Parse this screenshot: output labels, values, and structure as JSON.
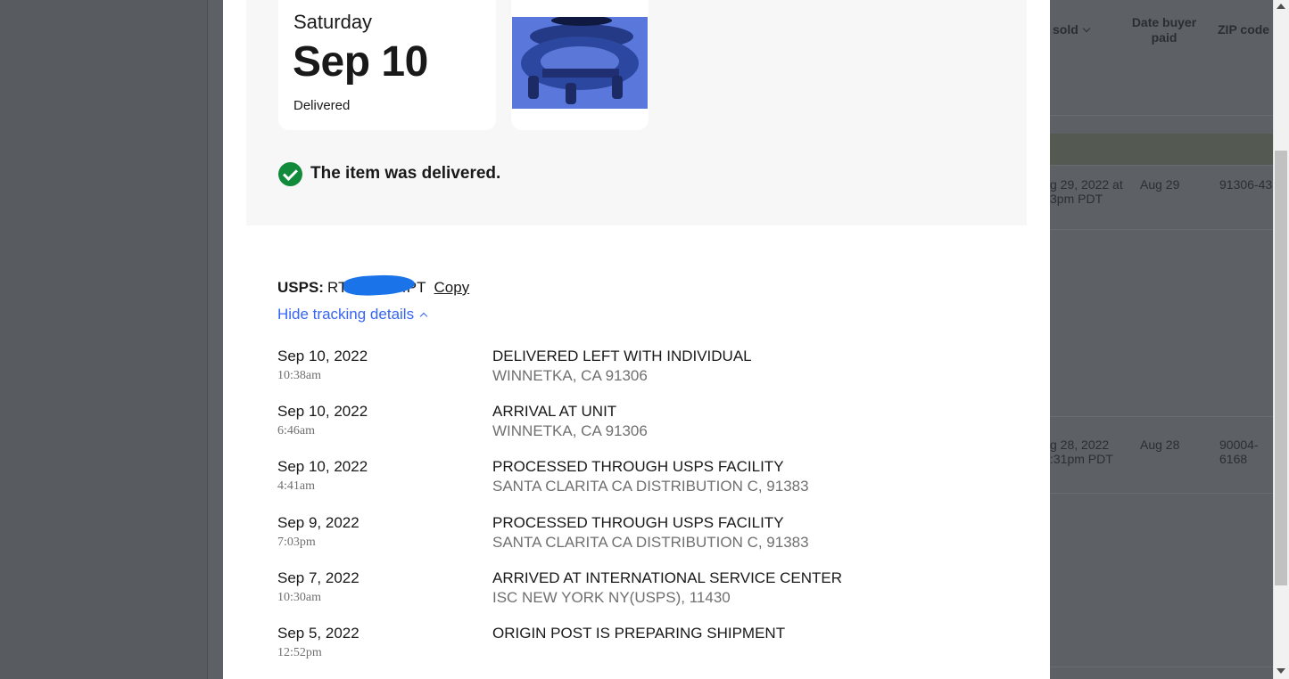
{
  "summary": {
    "day_of_week": "Saturday",
    "date": "Sep 10",
    "status": "Delivered",
    "delivered_message": "The item was delivered."
  },
  "tracking": {
    "carrier_label": "USPS:",
    "number_prefix": "RT",
    "number_suffix": "4PT",
    "copy_label": "Copy",
    "hide_details_label": "Hide tracking details",
    "events": [
      {
        "date": "Sep 10, 2022",
        "time": "10:38am",
        "status": "DELIVERED LEFT WITH INDIVIDUAL",
        "location": "WINNETKA, CA 91306"
      },
      {
        "date": "Sep 10, 2022",
        "time": "6:46am",
        "status": "ARRIVAL AT UNIT",
        "location": "WINNETKA, CA 91306"
      },
      {
        "date": "Sep 10, 2022",
        "time": "4:41am",
        "status": "PROCESSED THROUGH USPS FACILITY",
        "location": "SANTA CLARITA CA DISTRIBUTION C, 91383"
      },
      {
        "date": "Sep 9, 2022",
        "time": "7:03pm",
        "status": "PROCESSED THROUGH USPS FACILITY",
        "location": "SANTA CLARITA CA DISTRIBUTION C, 91383"
      },
      {
        "date": "Sep 7, 2022",
        "time": "10:30am",
        "status": "ARRIVED AT INTERNATIONAL SERVICE CENTER",
        "location": "ISC NEW YORK NY(USPS), 11430"
      },
      {
        "date": "Sep 5, 2022",
        "time": "12:52pm",
        "status": "ORIGIN POST IS PREPARING SHIPMENT",
        "location": ""
      }
    ]
  },
  "background_table": {
    "headers": {
      "sold": "sold",
      "date_buyer_paid": "Date buyer paid",
      "zip_code": "ZIP code"
    },
    "rows": [
      {
        "date_sold_line1": "g 29, 2022 at",
        "date_sold_line2": "3pm PDT",
        "paid": "Aug 29",
        "zip_line1": "91306-43",
        "zip_line2": ""
      },
      {
        "date_sold_line1": "g 28, 2022",
        "date_sold_line2": ":31pm PDT",
        "paid": "Aug 28",
        "zip_line1": "90004-",
        "zip_line2": "6168"
      }
    ]
  },
  "colors": {
    "accent_link": "#3665f3",
    "success_green": "#118a3c",
    "overlay": "#5d6166"
  }
}
